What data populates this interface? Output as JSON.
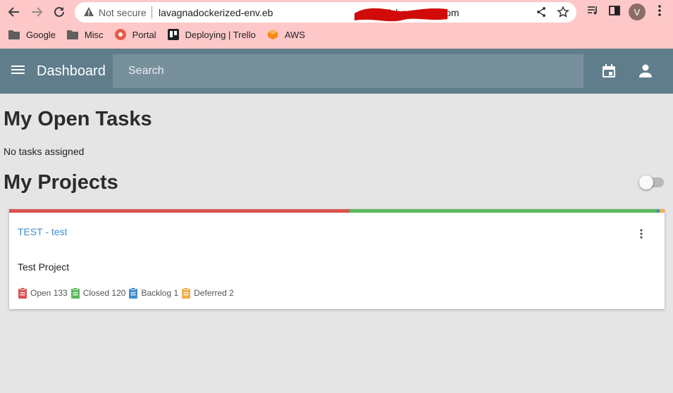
{
  "browser": {
    "security_label": "Not secure",
    "url_prefix": "lavagnadockerized-env.eb",
    "url_suffix": "lasticbeanstalk.com",
    "profile_initial": "V",
    "bookmarks": [
      {
        "label": "Google",
        "icon": "folder-icon"
      },
      {
        "label": "Misc",
        "icon": "folder-icon"
      },
      {
        "label": "Portal",
        "icon": "portal-icon"
      },
      {
        "label": "Deploying | Trello",
        "icon": "trello-icon"
      },
      {
        "label": "AWS",
        "icon": "aws-icon"
      }
    ]
  },
  "app": {
    "title": "Dashboard",
    "search_placeholder": "Search"
  },
  "open_tasks": {
    "heading": "My Open Tasks",
    "empty_text": "No tasks assigned"
  },
  "projects": {
    "heading": "My Projects",
    "items": [
      {
        "name": "TEST - test",
        "description": "Test Project",
        "stats": [
          {
            "label": "Open 133",
            "count": 133,
            "color": "#d9534f"
          },
          {
            "label": "Closed 120",
            "count": 120,
            "color": "#5cb85c"
          },
          {
            "label": "Backlog 1",
            "count": 1,
            "color": "#428bca"
          },
          {
            "label": "Deferred 2",
            "count": 2,
            "color": "#f0ad4e"
          }
        ]
      }
    ]
  },
  "colors": {
    "appbar": "#607d8b",
    "search_bg": "#78909c",
    "link": "#3d8fd1",
    "browser_frame": "#fec8c8"
  }
}
